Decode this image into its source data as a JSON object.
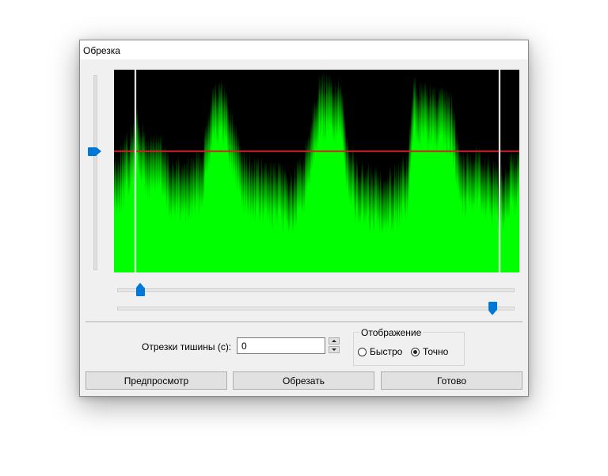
{
  "window": {
    "title": "Обрезка"
  },
  "colors": {
    "waveform": "#00ff00",
    "waveform_background": "#000000",
    "threshold_line": "#d0202a",
    "marker": "#ffffff",
    "slider_accent": "#0078d7"
  },
  "threshold_slider": {
    "value_fraction": 0.6
  },
  "start_slider": {
    "value_fraction": 0.05
  },
  "end_slider": {
    "value_fraction": 0.95
  },
  "silence": {
    "label": "Отрезки тишины (с):",
    "value": "0"
  },
  "display": {
    "legend": "Отображение",
    "fast_label": "Быстро",
    "exact_label": "Точно",
    "selected": "exact"
  },
  "buttons": {
    "preview": "Предпросмотр",
    "trim": "Обрезать",
    "done": "Готово"
  }
}
